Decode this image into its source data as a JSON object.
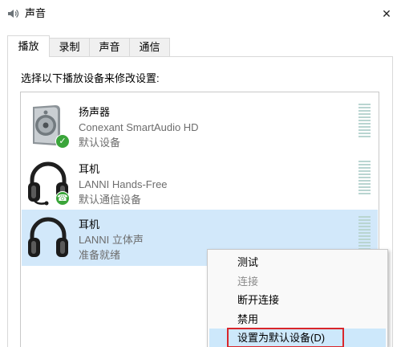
{
  "window": {
    "title": "声音",
    "close_glyph": "✕",
    "icon": "speaker-icon"
  },
  "tabs": [
    {
      "label": "播放",
      "selected": true
    },
    {
      "label": "录制",
      "selected": false
    },
    {
      "label": "声音",
      "selected": false
    },
    {
      "label": "通信",
      "selected": false
    }
  ],
  "instruction": "选择以下播放设备来修改设置:",
  "devices": [
    {
      "name": "扬声器",
      "driver": "Conexant SmartAudio HD",
      "status": "默认设备",
      "icon": "speaker-icon",
      "badge": "default-check-icon",
      "selected": false
    },
    {
      "name": "耳机",
      "driver": "LANNI Hands-Free",
      "status": "默认通信设备",
      "icon": "headset-icon",
      "badge": "communication-phone-icon",
      "selected": false
    },
    {
      "name": "耳机",
      "driver": "LANNI 立体声",
      "status": "准备就绪",
      "icon": "headphones-icon",
      "badge": null,
      "selected": true
    }
  ],
  "context_menu": {
    "items": [
      {
        "label": "测试",
        "disabled": false,
        "highlighted": false
      },
      {
        "label": "连接",
        "disabled": true,
        "highlighted": false
      },
      {
        "label": "断开连接",
        "disabled": false,
        "highlighted": false
      },
      {
        "label": "禁用",
        "disabled": false,
        "highlighted": false
      },
      {
        "label": "设置为默认设备(D)",
        "disabled": false,
        "highlighted": true,
        "annotated": true
      }
    ]
  },
  "colors": {
    "row_selected": "#d2e8fa",
    "menu_highlight": "#cde8fb",
    "annotation_red": "#d9262b",
    "badge_green": "#3aa53a"
  }
}
